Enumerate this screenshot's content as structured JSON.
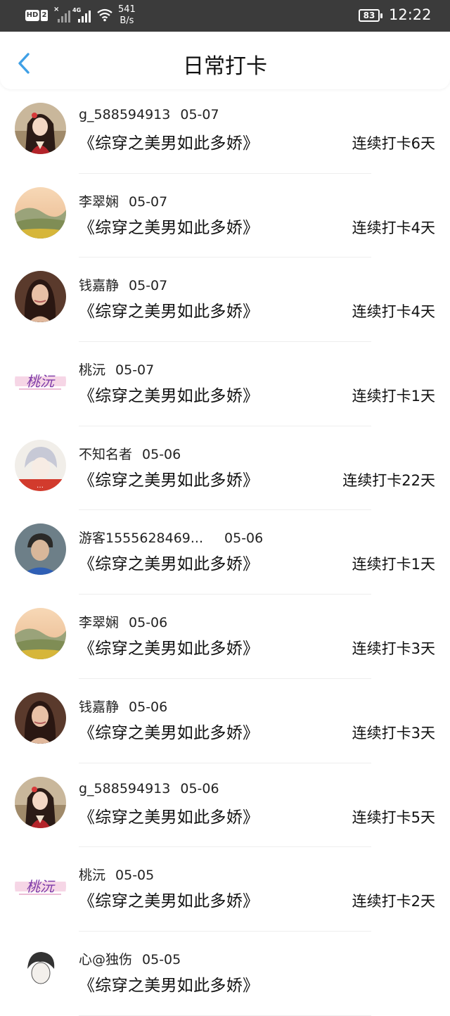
{
  "status_bar": {
    "hd": "HD",
    "sim": "2",
    "network": "4G",
    "speed_value": "541",
    "speed_unit": "B/s",
    "battery": "83",
    "time": "12:22"
  },
  "header": {
    "title": "日常打卡"
  },
  "records": [
    {
      "user": "g_588594913",
      "date": "05-07",
      "book": "《综穿之美男如此多娇》",
      "streak": "连续打卡6天",
      "avatar": "avatar-girl-ancient"
    },
    {
      "user": "李翠娴",
      "date": "05-07",
      "book": "《综穿之美男如此多娇》",
      "streak": "连续打卡4天",
      "avatar": "avatar-landscape"
    },
    {
      "user": "钱嘉静",
      "date": "05-07",
      "book": "《综穿之美男如此多娇》",
      "streak": "连续打卡4天",
      "avatar": "avatar-woman-portrait"
    },
    {
      "user": "桃沅",
      "date": "05-07",
      "book": "《综穿之美男如此多娇》",
      "streak": "连续打卡1天",
      "avatar": "avatar-text-logo"
    },
    {
      "user": "不知名者",
      "date": "05-06",
      "book": "《综穿之美男如此多娇》",
      "streak": "连续打卡22天",
      "avatar": "avatar-anime-boy"
    },
    {
      "user": "游客1555628469...",
      "date": "05-06",
      "book": "《综穿之美男如此多娇》",
      "streak": "连续打卡1天",
      "avatar": "avatar-man-portrait"
    },
    {
      "user": "李翠娴",
      "date": "05-06",
      "book": "《综穿之美男如此多娇》",
      "streak": "连续打卡3天",
      "avatar": "avatar-landscape"
    },
    {
      "user": "钱嘉静",
      "date": "05-06",
      "book": "《综穿之美男如此多娇》",
      "streak": "连续打卡3天",
      "avatar": "avatar-woman-portrait"
    },
    {
      "user": "g_588594913",
      "date": "05-06",
      "book": "《综穿之美男如此多娇》",
      "streak": "连续打卡5天",
      "avatar": "avatar-girl-ancient"
    },
    {
      "user": "桃沅",
      "date": "05-05",
      "book": "《综穿之美男如此多娇》",
      "streak": "连续打卡2天",
      "avatar": "avatar-text-logo"
    },
    {
      "user": "心@独伤",
      "date": "05-05",
      "book": "《综穿之美男如此多娇》",
      "streak": "",
      "avatar": "avatar-sketch-boy"
    }
  ]
}
